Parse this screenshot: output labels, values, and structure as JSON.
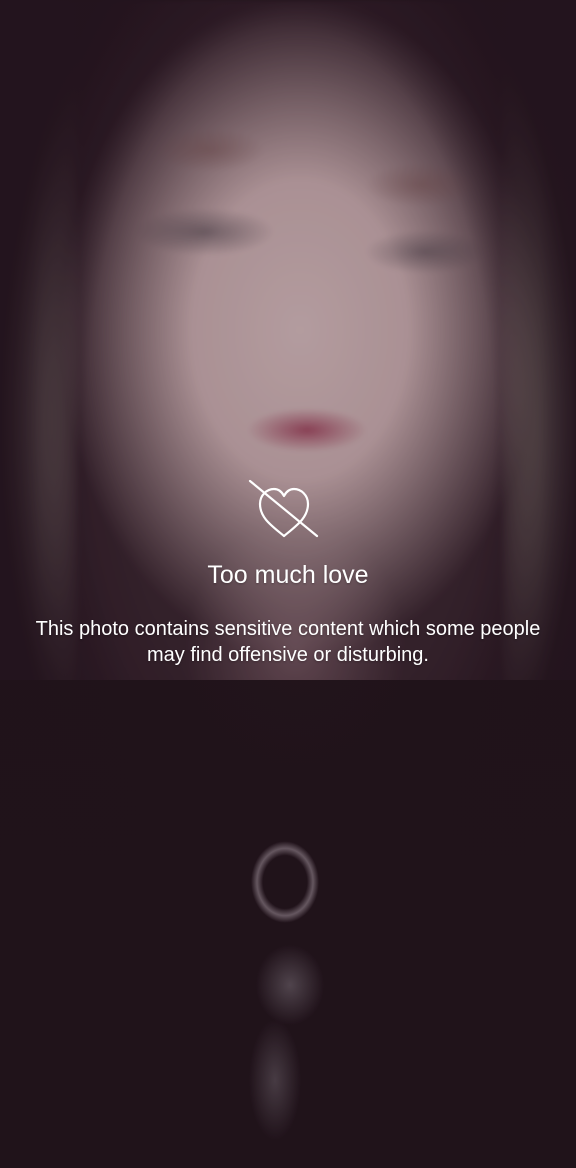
{
  "warning": {
    "icon": "heart-slash-icon",
    "title": "Too much love",
    "message": "This photo contains sensitive content which some people may find offensive or disturbing."
  },
  "colors": {
    "text": "#ffffff",
    "lips": "#a0465f",
    "background_dark": "#23151d"
  }
}
